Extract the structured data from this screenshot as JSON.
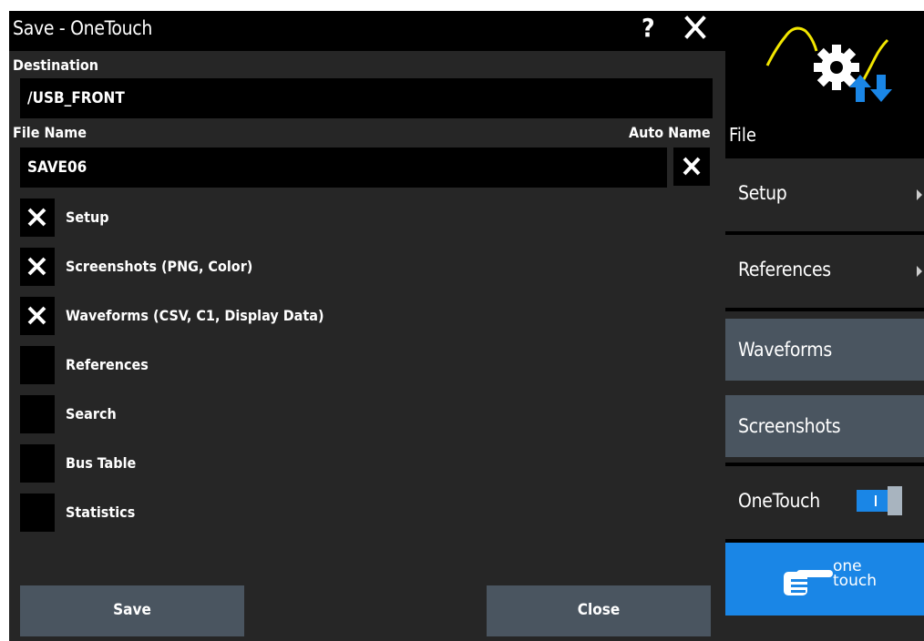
{
  "dialog": {
    "title": "Save - OneTouch",
    "help_label": "?",
    "destination_label": "Destination",
    "destination_value": "/USB_FRONT",
    "filename_label": "File Name",
    "filename_value": "SAVE06",
    "autoname_label": "Auto Name",
    "autoname_checked": true,
    "options": [
      {
        "label": "Setup",
        "checked": true
      },
      {
        "label": "Screenshots (PNG, Color)",
        "checked": true
      },
      {
        "label": "Waveforms (CSV, C1, Display Data)",
        "checked": true
      },
      {
        "label": "References",
        "checked": false
      },
      {
        "label": "Search",
        "checked": false
      },
      {
        "label": "Bus Table",
        "checked": false
      },
      {
        "label": "Statistics",
        "checked": false
      }
    ],
    "save_label": "Save",
    "close_label": "Close"
  },
  "sidebar": {
    "section_label": "File",
    "items": [
      {
        "label": "Setup",
        "submenu": true
      },
      {
        "label": "References",
        "submenu": true
      },
      {
        "label": "Waveforms",
        "active": true
      },
      {
        "label": "Screenshots",
        "active": true
      },
      {
        "label": "OneTouch",
        "toggle_on": true
      }
    ],
    "onetouch_text_top": "one",
    "onetouch_text_bottom": "touch"
  },
  "colors": {
    "background": "#000000",
    "panel": "#262626",
    "button": "#4a5560",
    "accent_blue": "#1a86e6",
    "waveform_yellow": "#f2e600"
  },
  "icons": [
    "close-icon",
    "help-icon",
    "check-icon",
    "submenu-arrow-icon",
    "gear-icon",
    "arrow-up-icon",
    "arrow-down-icon",
    "hand-pointer-icon",
    "toggle-switch"
  ]
}
